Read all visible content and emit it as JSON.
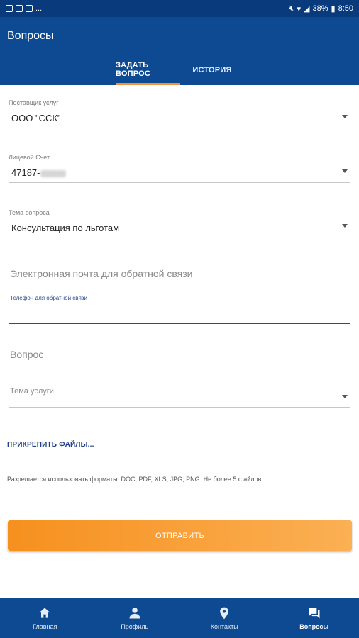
{
  "statusbar": {
    "dots": "...",
    "battery": "38%",
    "time": "8:50"
  },
  "appbar": {
    "title": "Вопросы"
  },
  "tabs": [
    {
      "label": "ЗАДАТЬ ВОПРОС",
      "active": true
    },
    {
      "label": "ИСТОРИЯ",
      "active": false
    }
  ],
  "form": {
    "provider": {
      "label": "Поставщик услуг",
      "value": "ООО \"ССК\""
    },
    "account": {
      "label": "Лицевой Счет",
      "value": "47187-"
    },
    "topic": {
      "label": "Тема вопроса",
      "value": "Консультация по льготам"
    },
    "email": {
      "placeholder": "Электронная почта для обратной связи"
    },
    "phone": {
      "label": "Телефон для обратной связи",
      "value": ""
    },
    "question": {
      "placeholder": "Вопрос"
    },
    "service_topic": {
      "placeholder": "Тема услуги"
    }
  },
  "attach_label": "ПРИКРЕПИТЬ ФАЙЛЫ...",
  "formats_note": "Разрешается использовать форматы: DOC, PDF, XLS, JPG, PNG. Не более 5 файлов.",
  "submit_label": "ОТПРАВИТЬ",
  "bottom_nav": [
    {
      "label": "Главная",
      "icon": "home-icon",
      "active": false
    },
    {
      "label": "Профиль",
      "icon": "person-icon",
      "active": false
    },
    {
      "label": "Контакты",
      "icon": "location-pin-icon",
      "active": false
    },
    {
      "label": "Вопросы",
      "icon": "chat-bubbles-icon",
      "active": true
    }
  ],
  "colors": {
    "primary": "#0e4a91",
    "accent": "#f6901e",
    "focus": "#2b4b8f"
  }
}
